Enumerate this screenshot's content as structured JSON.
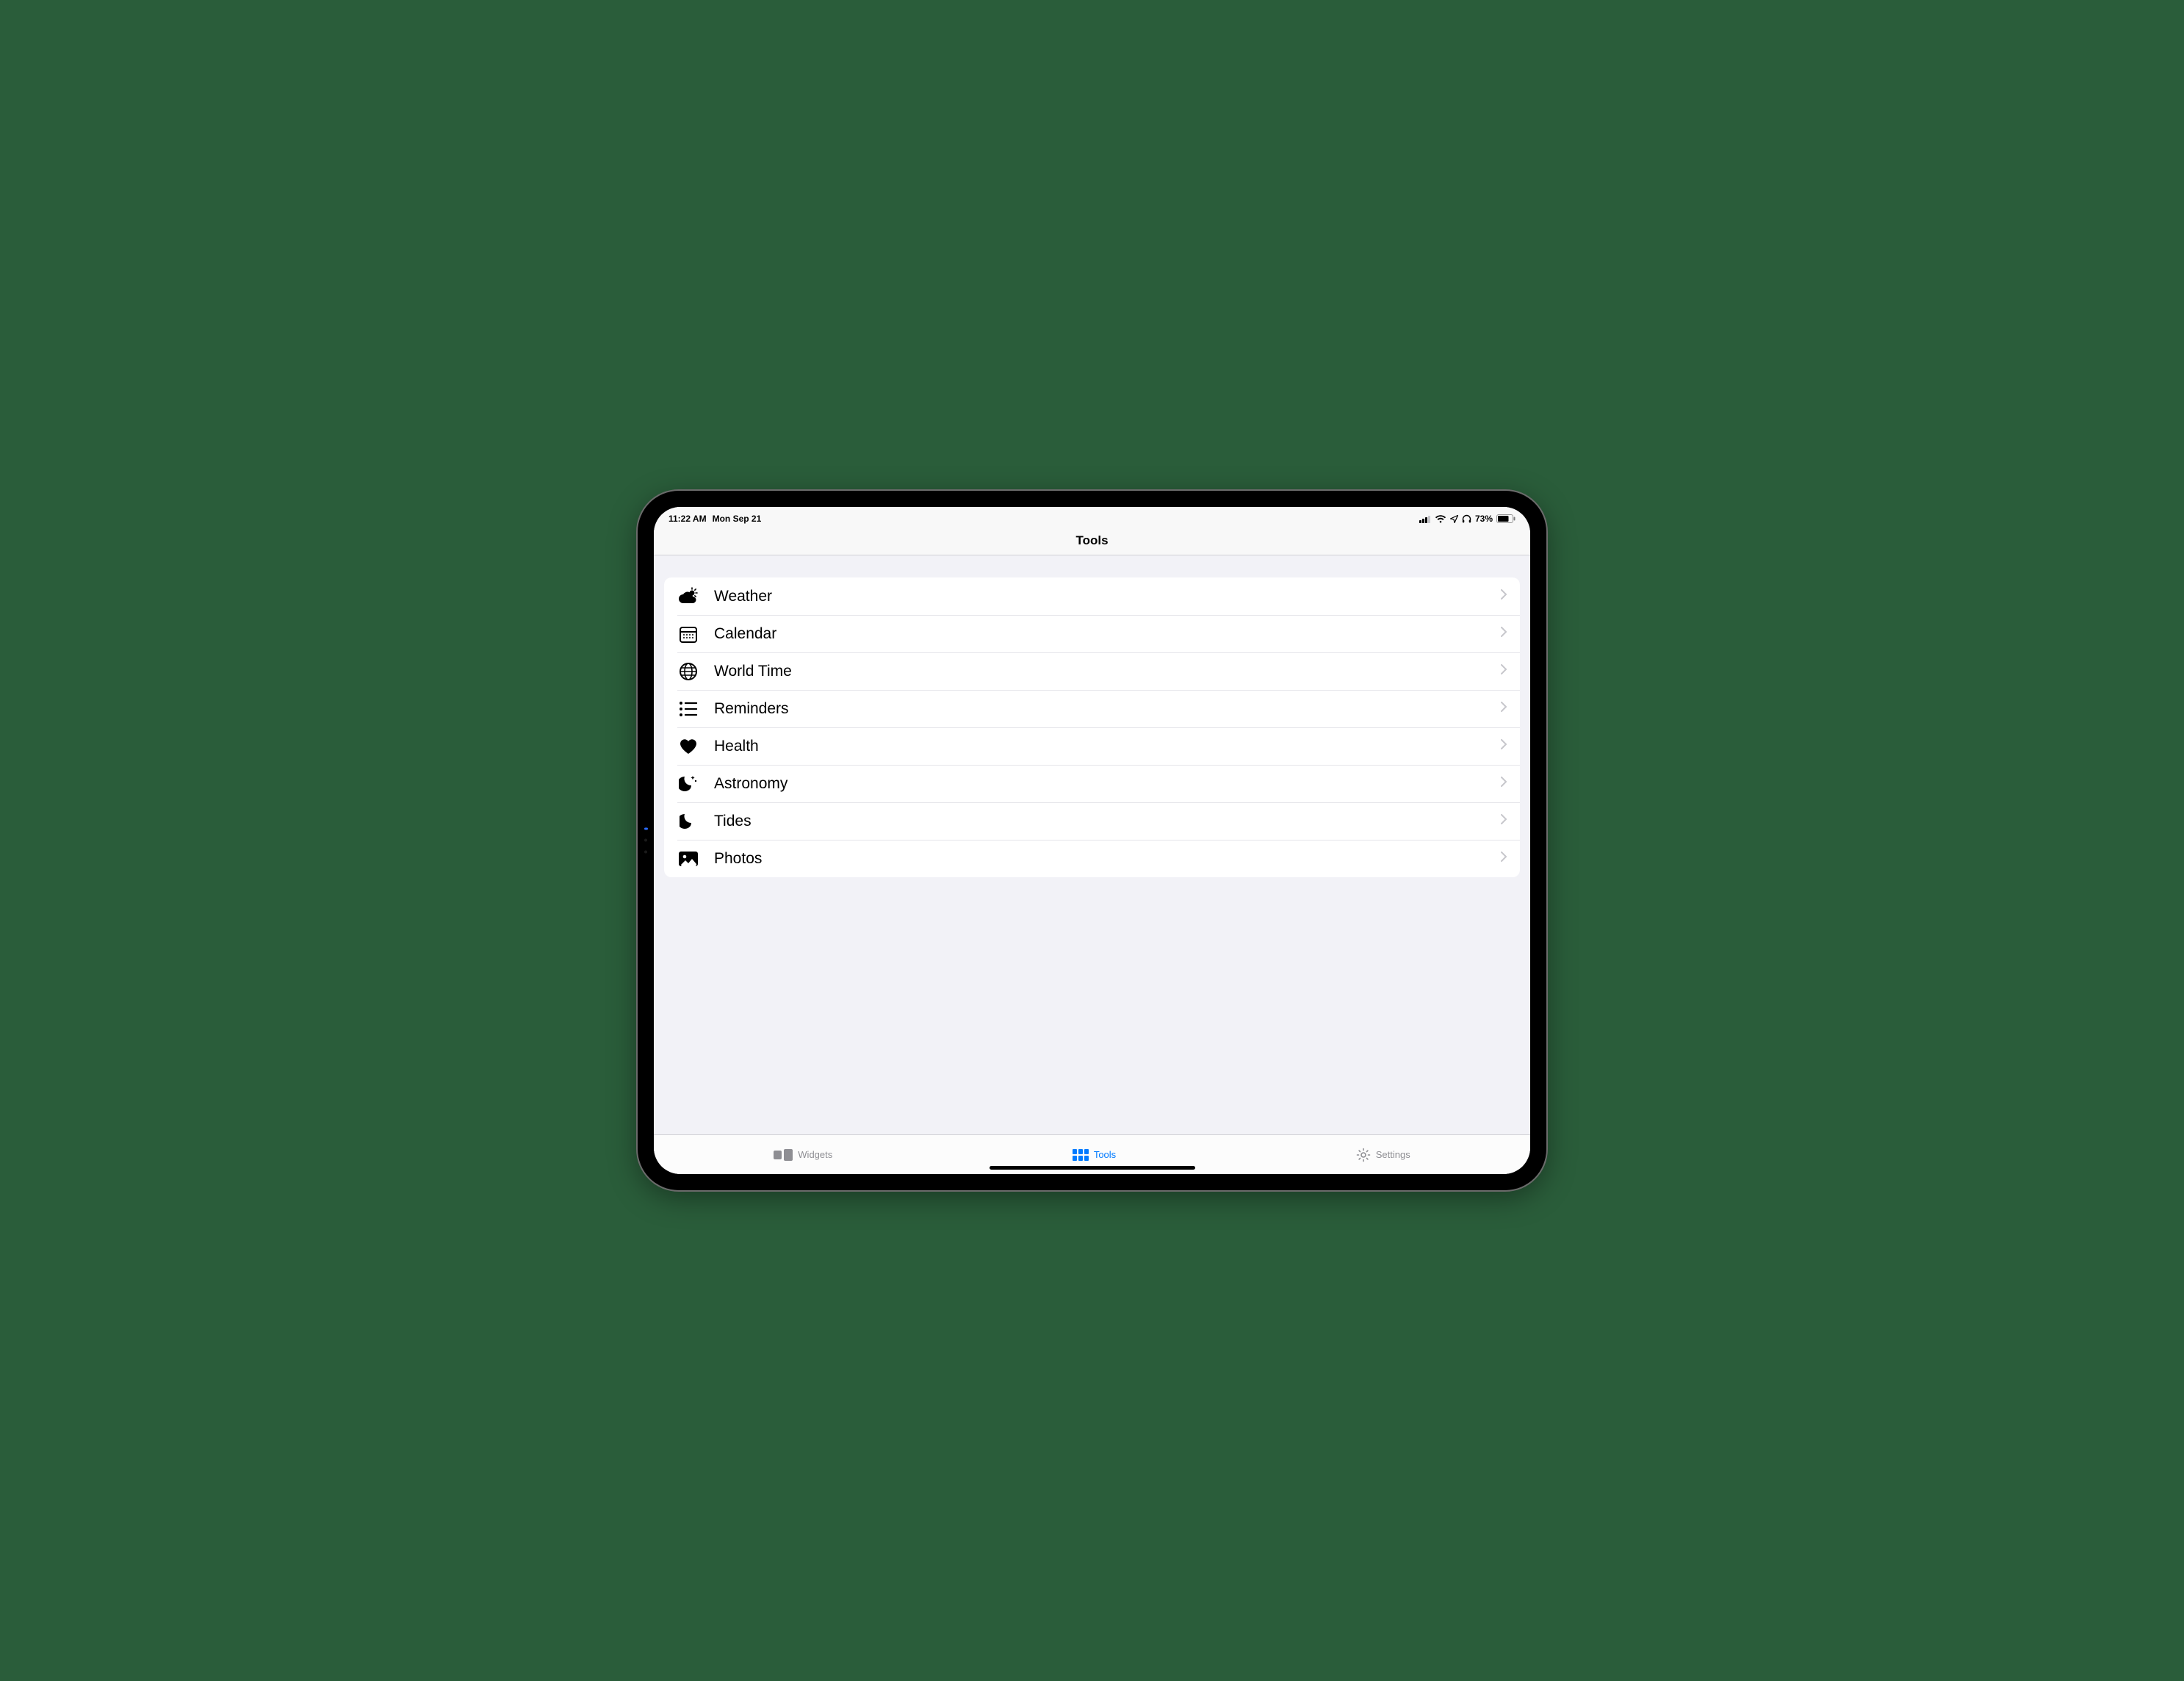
{
  "status": {
    "time": "11:22 AM",
    "date": "Mon Sep 21",
    "battery_pct": "73%"
  },
  "header": {
    "title": "Tools"
  },
  "tools": [
    {
      "id": "weather",
      "label": "Weather",
      "icon": "weather-icon"
    },
    {
      "id": "calendar",
      "label": "Calendar",
      "icon": "calendar-icon"
    },
    {
      "id": "worldtime",
      "label": "World Time",
      "icon": "globe-icon"
    },
    {
      "id": "reminders",
      "label": "Reminders",
      "icon": "list-icon"
    },
    {
      "id": "health",
      "label": "Health",
      "icon": "heart-icon"
    },
    {
      "id": "astronomy",
      "label": "Astronomy",
      "icon": "moon-stars-icon"
    },
    {
      "id": "tides",
      "label": "Tides",
      "icon": "moon-icon"
    },
    {
      "id": "photos",
      "label": "Photos",
      "icon": "photo-icon"
    }
  ],
  "tabs": {
    "widgets": {
      "label": "Widgets",
      "active": false
    },
    "tools": {
      "label": "Tools",
      "active": true
    },
    "settings": {
      "label": "Settings",
      "active": false
    }
  }
}
